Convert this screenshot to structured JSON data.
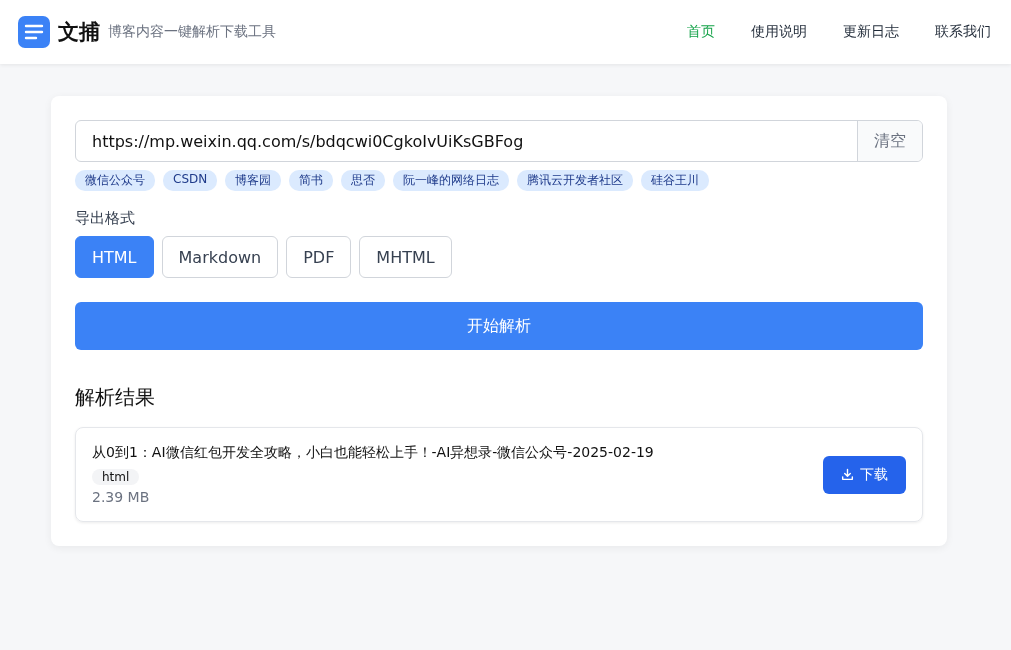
{
  "header": {
    "logo": "文捕",
    "tagline": "博客内容一键解析下载工具",
    "nav": [
      {
        "label": "首页",
        "selected": true
      },
      {
        "label": "使用说明",
        "selected": false
      },
      {
        "label": "更新日志",
        "selected": false
      },
      {
        "label": "联系我们",
        "selected": false
      }
    ]
  },
  "url_field": {
    "value": "https://mp.weixin.qq.com/s/bdqcwi0CgkoIvUiKsGBFog",
    "clear_button": "清空"
  },
  "sources": [
    "微信公众号",
    "CSDN",
    "博客园",
    "简书",
    "思否",
    "阮一峰的网络日志",
    "腾讯云开发者社区",
    "硅谷王川"
  ],
  "format": {
    "label": "导出格式",
    "options": [
      {
        "label": "HTML",
        "selected": true
      },
      {
        "label": "Markdown",
        "selected": false
      },
      {
        "label": "PDF",
        "selected": false
      },
      {
        "label": "MHTML",
        "selected": false
      }
    ]
  },
  "parse_button": "开始解析",
  "results": {
    "title": "解析结果",
    "items": [
      {
        "name": "从0到1：AI微信红包开发全攻略，小白也能轻松上手！-AI异想录-微信公众号-2025-02-19",
        "format": "html",
        "size": "2.39 MB",
        "download": "下载"
      }
    ]
  }
}
